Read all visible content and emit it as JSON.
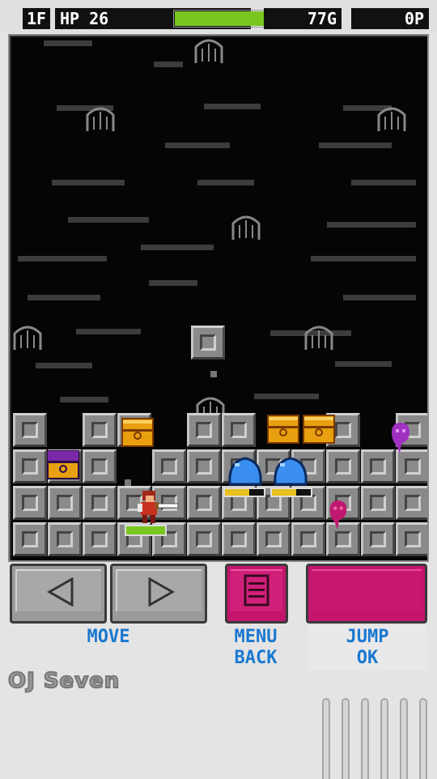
{
  "hud": {
    "floor": "1F",
    "hp_label": "HP 26",
    "hp_fraction": 0.84,
    "gold": "77G",
    "points": "0P"
  },
  "hero": {
    "hp_fraction": 1.0
  },
  "enemies": [
    {
      "type": "blue-slime",
      "hp_fraction": 0.62
    },
    {
      "type": "blue-slime",
      "hp_fraction": 0.62
    }
  ],
  "controls": {
    "move_label": "MOVE",
    "menu_label_1": "MENU",
    "menu_label_2": "BACK",
    "jump_label_1": "JUMP",
    "jump_label_2": "OK"
  },
  "branding": {
    "logo_text": "OJ Seven"
  },
  "colors": {
    "hp_green": "#7ac620",
    "enemy_hp_yellow": "#e8c020",
    "button_magenta": "#c4156c",
    "label_blue": "#1a78d0",
    "chest_gold": "#e8a010",
    "chest_purple": "#7a2aa8",
    "ghost_purple": "#a030c0",
    "ghost_magenta": "#c01870"
  },
  "icons": [
    "left-arrow-icon",
    "right-arrow-icon",
    "menu-lines-icon"
  ]
}
